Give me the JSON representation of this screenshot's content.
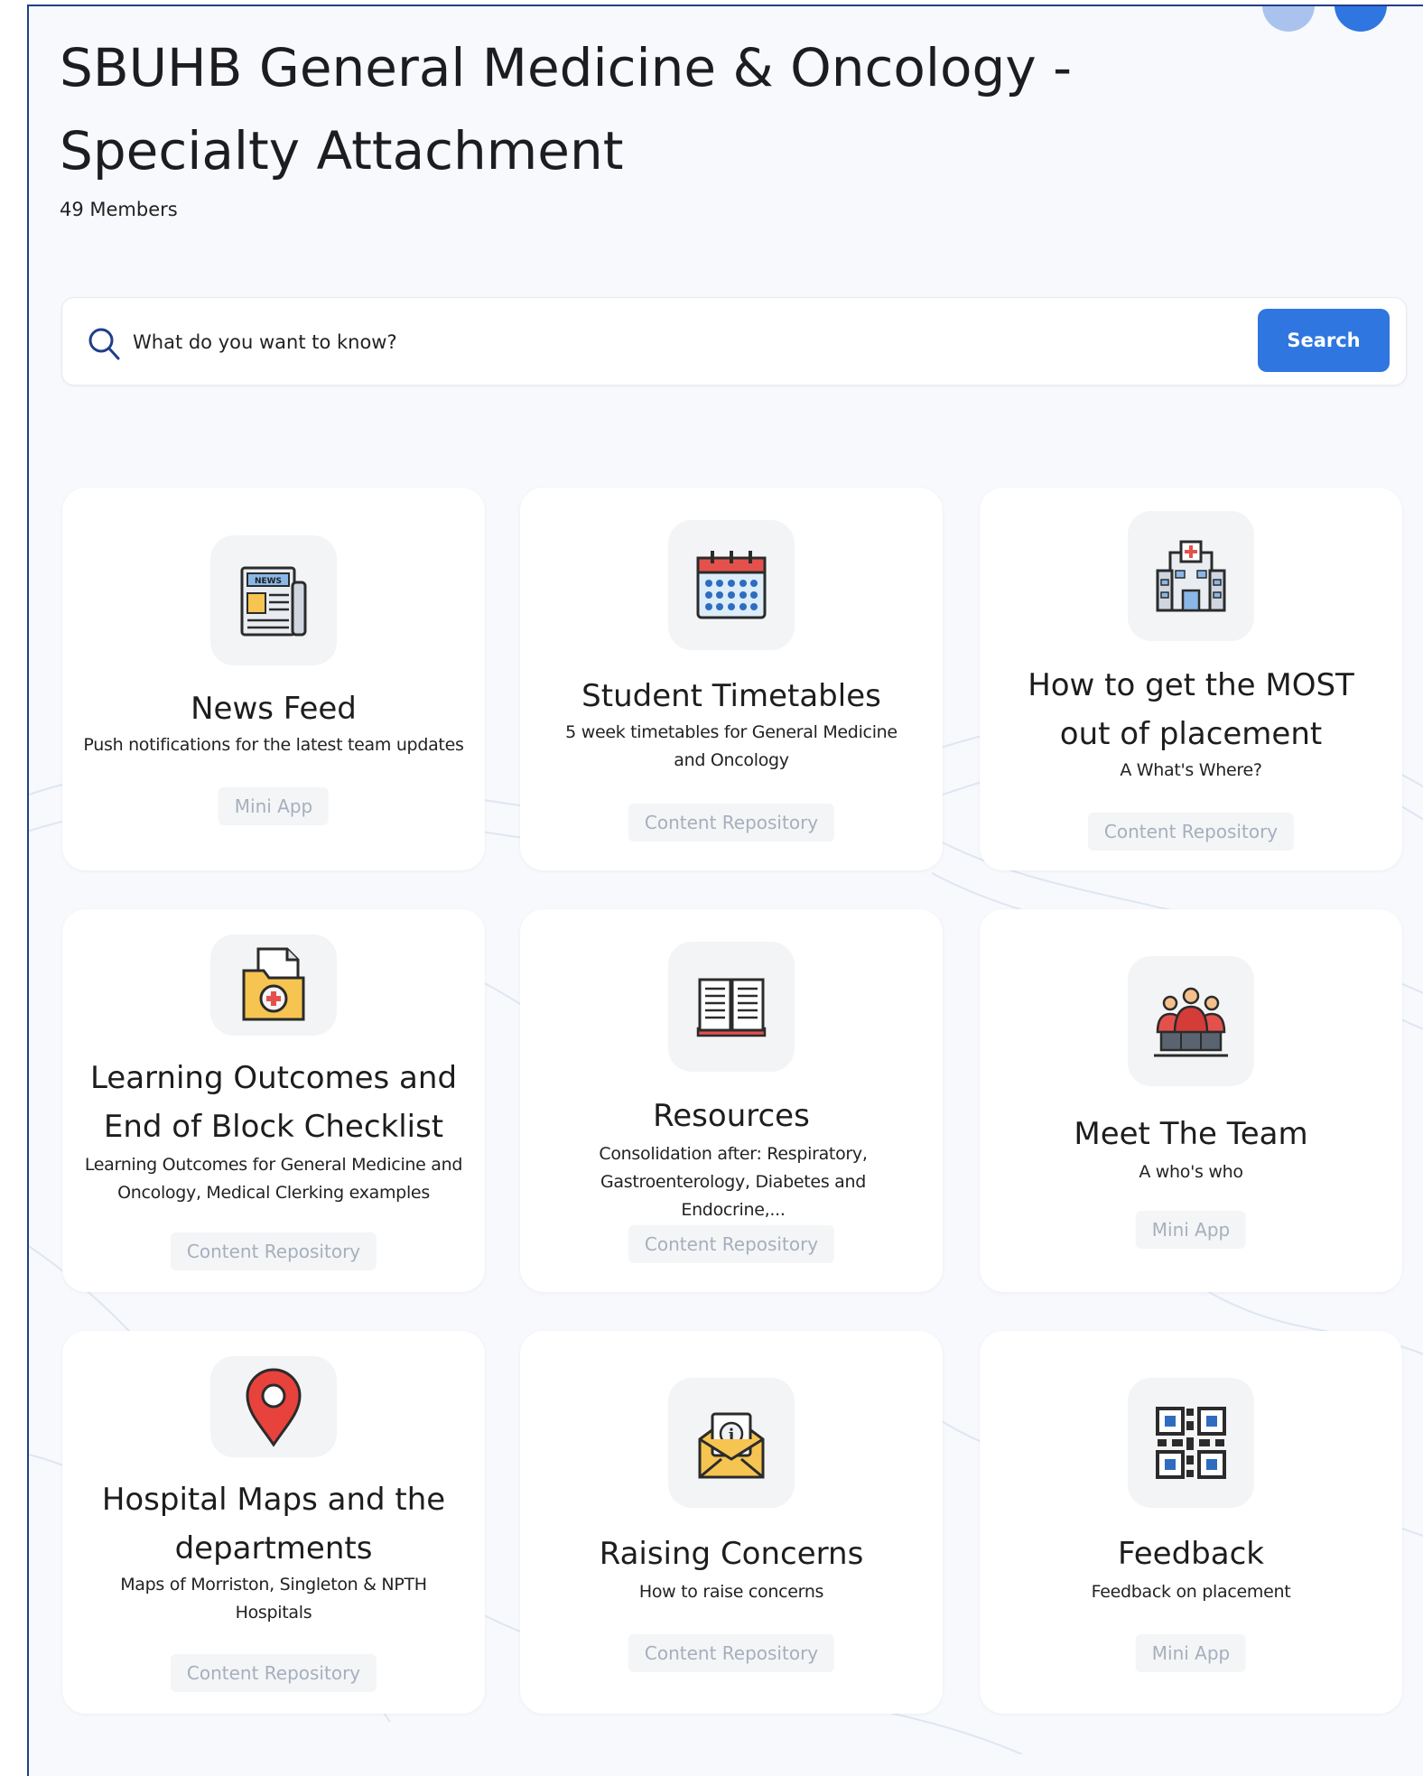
{
  "page": {
    "title": "SBUHB General Medicine & Oncology - Specialty Attachment",
    "members": "49 Members"
  },
  "search": {
    "placeholder": "What do you want to know?",
    "button_label": "Search"
  },
  "colors": {
    "accent": "#2f76e0",
    "frame_border": "#1f3f8a",
    "tag_text": "#a6afbd"
  },
  "cards": [
    {
      "title": "News Feed",
      "description": "Push notifications for the latest team updates",
      "tag": "Mini App",
      "icon": "newspaper-icon"
    },
    {
      "title": "Student Timetables",
      "description": "5 week timetables for General Medicine and Oncology",
      "tag": "Content Repository",
      "icon": "calendar-icon"
    },
    {
      "title": "How to get the MOST out of placement",
      "description": "A What's Where?",
      "tag": "Content Repository",
      "icon": "hospital-icon"
    },
    {
      "title": "Learning Outcomes and End of Block Checklist",
      "description": "Learning Outcomes for General Medicine and Oncology, Medical Clerking examples",
      "tag": "Content Repository",
      "icon": "medical-folder-icon"
    },
    {
      "title": "Resources",
      "description": "Consolidation after: Respiratory, Gastroenterology, Diabetes and Endocrine,...",
      "tag": "Content Repository",
      "icon": "open-book-icon"
    },
    {
      "title": "Meet The Team",
      "description": "A who's who",
      "tag": "Mini App",
      "icon": "team-icon"
    },
    {
      "title": "Hospital Maps and the departments",
      "description": "Maps of Morriston, Singleton & NPTH Hospitals",
      "tag": "Content Repository",
      "icon": "map-pin-icon"
    },
    {
      "title": "Raising Concerns",
      "description": "How to raise concerns",
      "tag": "Content Repository",
      "icon": "info-envelope-icon"
    },
    {
      "title": "Feedback",
      "description": "Feedback on placement",
      "tag": "Mini App",
      "icon": "qr-code-icon"
    }
  ]
}
